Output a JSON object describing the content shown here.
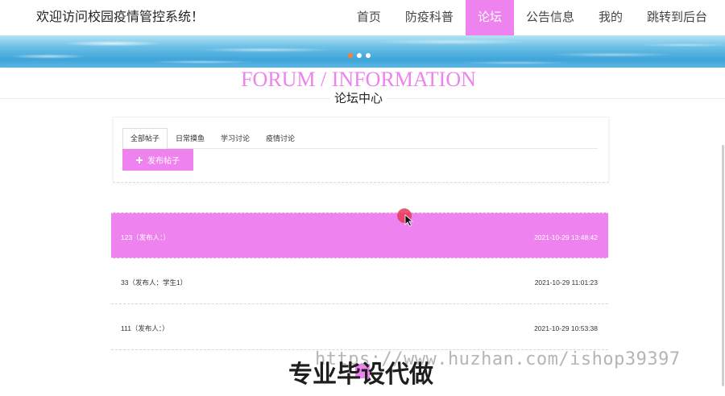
{
  "colors": {
    "accent": "#ee82ee",
    "carousel_active": "#ff7f27",
    "text": "#333333"
  },
  "header": {
    "site_title": "欢迎访问校园疫情管控系统！",
    "active_nav_index": 2,
    "nav": [
      {
        "label": "首页"
      },
      {
        "label": "防疫科普"
      },
      {
        "label": "论坛"
      },
      {
        "label": "公告信息"
      },
      {
        "label": "我的"
      },
      {
        "label": "跳转到后台"
      }
    ]
  },
  "banner": {
    "slide_count": 3,
    "active_slide_index": 0
  },
  "section": {
    "title_en": "FORUM / INFORMATION",
    "title_cn": "论坛中心"
  },
  "forum": {
    "active_tab_index": 0,
    "tabs": [
      {
        "label": "全部帖子"
      },
      {
        "label": "日常摸鱼"
      },
      {
        "label": "学习讨论"
      },
      {
        "label": "疫情讨论"
      }
    ],
    "publish_button": {
      "icon": "plus-icon",
      "label": "发布帖子"
    },
    "hovered_post_index": 0,
    "posts": [
      {
        "title": "123（发布人：）",
        "time": "2021-10-29 13:48:42"
      },
      {
        "title": "33（发布人：学生1）",
        "time": "2021-10-29 11:01:23"
      },
      {
        "title": "111（发布人：）",
        "time": "2021-10-29 10:53:38"
      }
    ]
  },
  "overlay": {
    "watermark_url": "https://www.huzhan.com/ishop39397",
    "slogan": "专业毕设代做",
    "cursor_icon": "mouse-pointer-icon"
  }
}
